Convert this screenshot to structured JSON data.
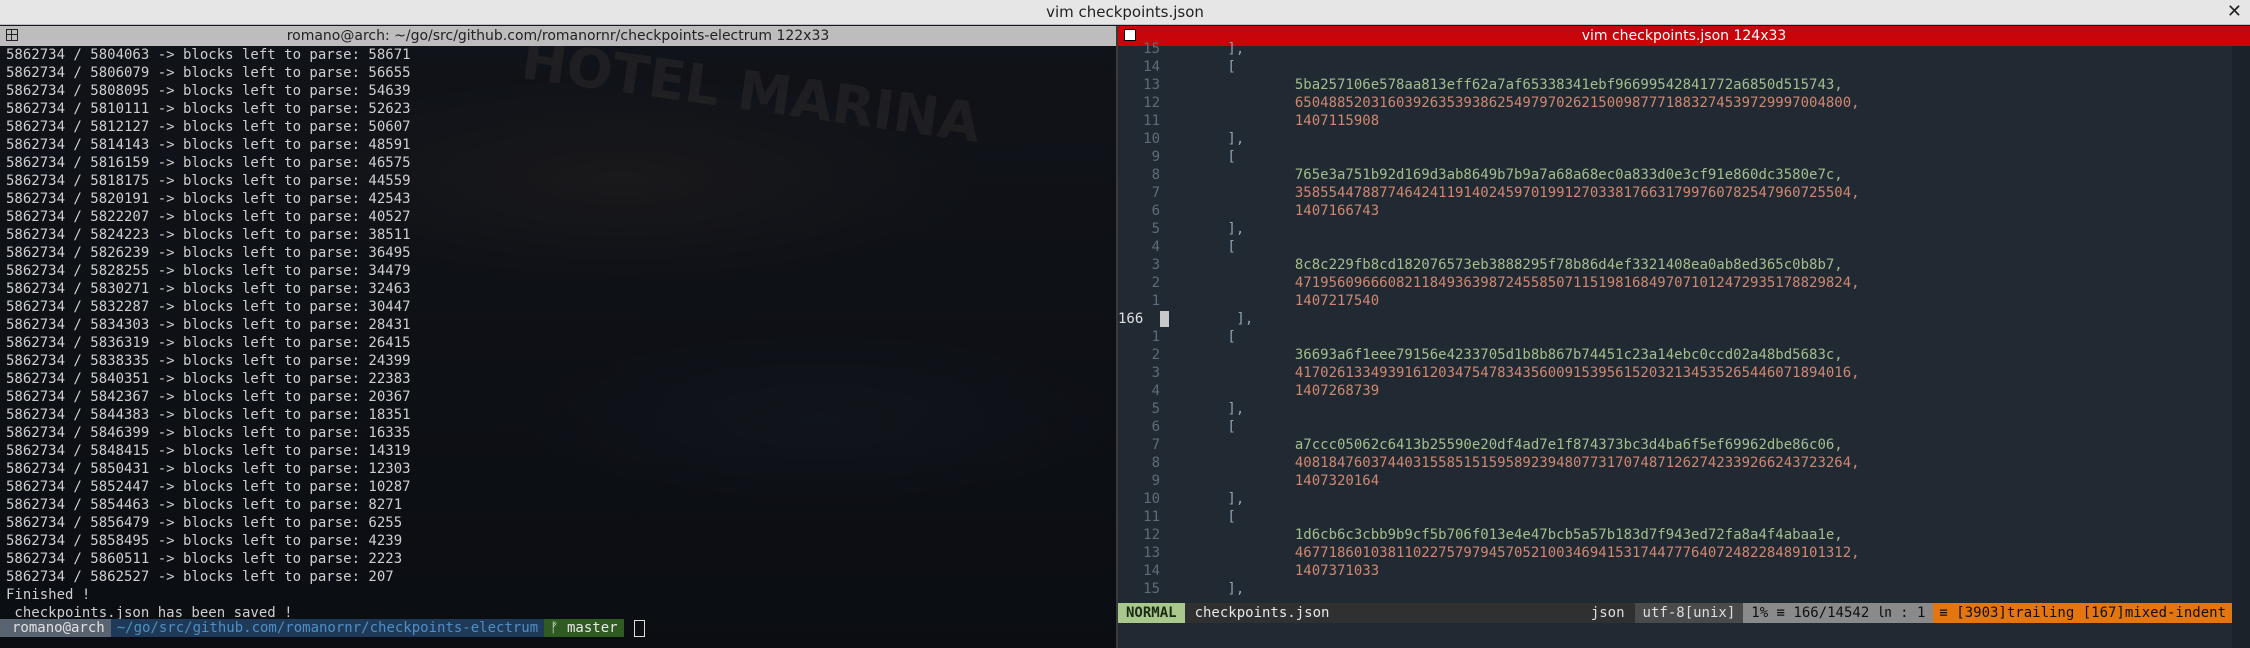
{
  "window": {
    "title": "vim checkpoints.json",
    "close_glyph": "✕"
  },
  "left_pane": {
    "title": "romano@arch: ~/go/src/github.com/romanornr/checkpoints-electrum 122x33",
    "lines": [
      "5862734 / 5804063 -> blocks left to parse: 58671",
      "5862734 / 5806079 -> blocks left to parse: 56655",
      "5862734 / 5808095 -> blocks left to parse: 54639",
      "5862734 / 5810111 -> blocks left to parse: 52623",
      "5862734 / 5812127 -> blocks left to parse: 50607",
      "5862734 / 5814143 -> blocks left to parse: 48591",
      "5862734 / 5816159 -> blocks left to parse: 46575",
      "5862734 / 5818175 -> blocks left to parse: 44559",
      "5862734 / 5820191 -> blocks left to parse: 42543",
      "5862734 / 5822207 -> blocks left to parse: 40527",
      "5862734 / 5824223 -> blocks left to parse: 38511",
      "5862734 / 5826239 -> blocks left to parse: 36495",
      "5862734 / 5828255 -> blocks left to parse: 34479",
      "5862734 / 5830271 -> blocks left to parse: 32463",
      "5862734 / 5832287 -> blocks left to parse: 30447",
      "5862734 / 5834303 -> blocks left to parse: 28431",
      "5862734 / 5836319 -> blocks left to parse: 26415",
      "5862734 / 5838335 -> blocks left to parse: 24399",
      "5862734 / 5840351 -> blocks left to parse: 22383",
      "5862734 / 5842367 -> blocks left to parse: 20367",
      "5862734 / 5844383 -> blocks left to parse: 18351",
      "5862734 / 5846399 -> blocks left to parse: 16335",
      "5862734 / 5848415 -> blocks left to parse: 14319",
      "5862734 / 5850431 -> blocks left to parse: 12303",
      "5862734 / 5852447 -> blocks left to parse: 10287",
      "5862734 / 5854463 -> blocks left to parse: 8271",
      "5862734 / 5856479 -> blocks left to parse: 6255",
      "5862734 / 5858495 -> blocks left to parse: 4239",
      "5862734 / 5860511 -> blocks left to parse: 2223",
      "5862734 / 5862527 -> blocks left to parse: 207",
      "Finished !",
      " checkpoints.json has been saved !"
    ],
    "prompt": {
      "user": "romano@arch",
      "path": "~/go/src/github.com/romanornr/checkpoints-electrum",
      "branch": "ᚠ master"
    }
  },
  "right_pane": {
    "title": "vim checkpoints.json 124x33",
    "lines": [
      {
        "n": "15",
        "text": "        ],",
        "kind": "code"
      },
      {
        "n": "14",
        "text": "        [",
        "kind": "code"
      },
      {
        "n": "13",
        "text": "                5ba257106e578aa813eff62a7af65338341ebf96699542841772a6850d515743,",
        "kind": "str"
      },
      {
        "n": "12",
        "text": "                650488520316039263539386254979702621500987771883274539729997004800,",
        "kind": "num"
      },
      {
        "n": "11",
        "text": "                1407115908",
        "kind": "num"
      },
      {
        "n": "10",
        "text": "        ],",
        "kind": "code"
      },
      {
        "n": "9",
        "text": "        [",
        "kind": "code"
      },
      {
        "n": "8",
        "text": "                765e3a751b92d169d3ab8649b7b9a7a68a68ec0a833d0e3cf91e860dc3580e7c,",
        "kind": "str"
      },
      {
        "n": "7",
        "text": "                358554478877464241191402459701991270338176631799760782547960725504,",
        "kind": "num"
      },
      {
        "n": "6",
        "text": "                1407166743",
        "kind": "num"
      },
      {
        "n": "5",
        "text": "        ],",
        "kind": "code"
      },
      {
        "n": "4",
        "text": "        [",
        "kind": "code"
      },
      {
        "n": "3",
        "text": "                8c8c229fb8cd182076573eb3888295f78b86d4ef3321408ea0ab8ed365c0b8b7,",
        "kind": "str"
      },
      {
        "n": "2",
        "text": "                471956096660821184936398724558507115198168497071012472935178829824,",
        "kind": "num"
      },
      {
        "n": "1",
        "text": "                1407217540",
        "kind": "num"
      },
      {
        "n": "166",
        "text": "        ],",
        "kind": "cursor"
      },
      {
        "n": "1",
        "text": "        [",
        "kind": "code"
      },
      {
        "n": "2",
        "text": "                36693a6f1eee79156e4233705d1b8b867b74451c23a14ebc0ccd02a48bd5683c,",
        "kind": "str"
      },
      {
        "n": "3",
        "text": "                417026133493916120347547834356009153956152032134535265446071894016,",
        "kind": "num"
      },
      {
        "n": "4",
        "text": "                1407268739",
        "kind": "num"
      },
      {
        "n": "5",
        "text": "        ],",
        "kind": "code"
      },
      {
        "n": "6",
        "text": "        [",
        "kind": "code"
      },
      {
        "n": "7",
        "text": "                a7ccc05062c6413b25590e20df4ad7e1f874373bc3d4ba6f5ef69962dbe86c06,",
        "kind": "str"
      },
      {
        "n": "8",
        "text": "                408184760374403155851515958923948077317074871262742339266243723264,",
        "kind": "num"
      },
      {
        "n": "9",
        "text": "                1407320164",
        "kind": "num"
      },
      {
        "n": "10",
        "text": "        ],",
        "kind": "code"
      },
      {
        "n": "11",
        "text": "        [",
        "kind": "code"
      },
      {
        "n": "12",
        "text": "                1d6cb6c3cbb9b9cf5b706f013e4e47bcb5a57b183d7f943ed72fa8a4f4abaa1e,",
        "kind": "str"
      },
      {
        "n": "13",
        "text": "                467718601038110227579794570521003469415317447776407248228489101312,",
        "kind": "num"
      },
      {
        "n": "14",
        "text": "                1407371033",
        "kind": "num"
      },
      {
        "n": "15",
        "text": "        ],",
        "kind": "code"
      }
    ],
    "status": {
      "mode": "NORMAL",
      "file": "checkpoints.json",
      "filetype": "json",
      "encoding": "utf-8[unix]",
      "position": "1% ≡ 166/14542 ㏑ :  1",
      "warnings": "≡ [3903]trailing [167]mixed-indent"
    }
  },
  "colors": {
    "accent_red": "#c8050a",
    "mode_green": "#a9c98c",
    "warn_orange": "#e5760e"
  }
}
